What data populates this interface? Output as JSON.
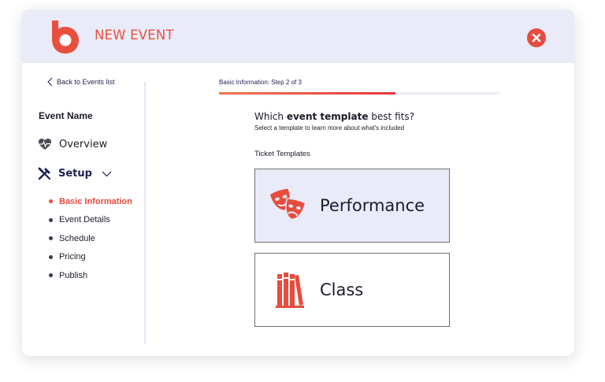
{
  "header": {
    "title": "NEW EVENT",
    "brand_color": "#ea4f3e",
    "logo_icon": "droplet-logo",
    "close_icon": "close-circle-icon"
  },
  "sidebar": {
    "back_link": "Back to Events list",
    "event_name": "Event Name",
    "overview": {
      "label": "Overview",
      "icon": "heart-pulse-icon"
    },
    "setup": {
      "label": "Setup",
      "icon": "tools-icon",
      "expanded": true
    },
    "steps": [
      {
        "label": "Basic Information",
        "active": true
      },
      {
        "label": "Event Details",
        "active": false
      },
      {
        "label": "Schedule",
        "active": false
      },
      {
        "label": "Pricing",
        "active": false
      },
      {
        "label": "Publish",
        "active": false
      }
    ]
  },
  "main": {
    "step_label": "Basic Information: Step 2 of 3",
    "progress_fraction": 0.63,
    "question_prefix": "Which",
    "question_bold": "event template",
    "question_suffix": "best fits?",
    "question_sub": "Select a template to learn more about what's included",
    "section_label": "Ticket Templates",
    "templates": [
      {
        "label": "Performance",
        "icon": "theater-masks-icon",
        "selected": true
      },
      {
        "label": "Class",
        "icon": "books-icon",
        "selected": false
      }
    ]
  },
  "colors": {
    "accent": "#e84c3d",
    "navy": "#1d2150",
    "header_bg": "#e9ebf8"
  }
}
